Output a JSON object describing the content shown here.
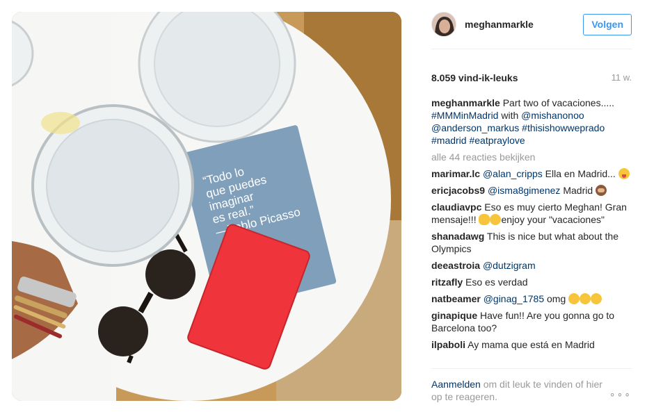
{
  "post": {
    "username": "meghanmarkle",
    "follow_label": "Volgen",
    "likes": "8.059 vind-ik-leuks",
    "time_ago": "11 w.",
    "book_quote": "“Todo lo que puedes imaginar es real.” —Pablo Picasso"
  },
  "caption": {
    "username": "meghanmarkle",
    "text_1": "Part two of vacaciones.....",
    "tag_1": "#MMMinMadrid",
    "text_2": "with",
    "mention_1": "@mishanonoo",
    "mention_2": "@anderson_markus",
    "tag_2": "#thisishowweprado",
    "tag_3": "#madrid",
    "tag_4": "#eatpraylove"
  },
  "view_all": "alle 44 reacties bekijken",
  "comments": [
    {
      "user": "marimar.lc",
      "mention": "@alan_cripps",
      "text": "Ella en Madrid..."
    },
    {
      "user": "ericjacobs9",
      "mention": "@isma8gimenez",
      "text": "Madrid"
    },
    {
      "user": "claudiavpc",
      "text": "Eso es muy cierto Meghan! Gran mensaje!!!",
      "text_2": "enjoy your \"vacaciones\""
    },
    {
      "user": "shanadawg",
      "text": "This is nice but what about the Olympics"
    },
    {
      "user": "deeastroia",
      "mention": "@dutzigram"
    },
    {
      "user": "ritzafly",
      "text": "Eso es verdad"
    },
    {
      "user": "natbeamer",
      "mention": "@ginag_1785",
      "text": "omg"
    },
    {
      "user": "ginapique",
      "text": "Have fun!! Are you gonna go to Barcelona too?"
    },
    {
      "user": "ilpaboli",
      "text": "Ay mama que está en Madrid"
    }
  ],
  "footer": {
    "login_label": "Aanmelden",
    "text": "om dit leuk te vinden of hier op te reageren.",
    "more_label": "∘∘∘"
  },
  "colors": {
    "link": "#003569",
    "follow": "#3897f0",
    "muted": "#999999",
    "notebook_red": "#f0343b",
    "notebook_blue": "#7f9fba"
  }
}
